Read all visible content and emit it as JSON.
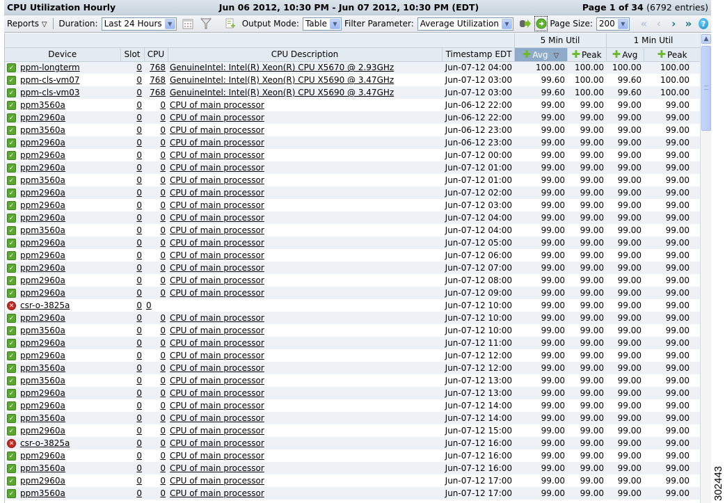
{
  "title": "CPU Utilization Hourly",
  "date_range": "Jun 06 2012, 10:30 PM - Jun 07 2012, 10:30 PM (EDT)",
  "pagination": {
    "page_label": "Page 1 of 34",
    "entries_label": "(6792 entries)"
  },
  "toolbar": {
    "reports_label": "Reports",
    "duration_label": "Duration:",
    "duration_value": "Last 24 Hours",
    "output_mode_label": "Output Mode:",
    "output_mode_value": "Table",
    "filter_param_label": "Filter Parameter:",
    "filter_param_value": "Average Utilization",
    "page_size_label": "Page Size:",
    "page_size_value": "200",
    "icons": [
      "calendar-icon",
      "filter-icon",
      "export-icon",
      "export-data-icon",
      "go-icon",
      "first-page-icon",
      "prev-page-icon",
      "next-page-icon",
      "last-page-icon",
      "help-icon"
    ]
  },
  "table": {
    "group_headers": {
      "five_min": "5 Min Util",
      "one_min": "1 Min Util"
    },
    "columns": {
      "device": "Device",
      "slot": "Slot",
      "cpu": "CPU",
      "cpu_desc": "CPU Description",
      "timestamp": "Timestamp EDT",
      "avg5": "Avg",
      "peak5": "Peak",
      "avg1": "Avg",
      "peak1": "Peak"
    },
    "sorted_column": "5 Min Util Avg",
    "rows": [
      {
        "status": "ok",
        "device": "ppm-longterm",
        "slot": "0",
        "cpu": "768",
        "desc": "GenuineIntel: Intel(R) Xeon(R) CPU X5670 @ 2.93GHz",
        "ts": "Jun-07-12 04:00",
        "avg5": "100.00",
        "peak5": "100.00",
        "avg1": "100.00",
        "peak1": "100.00"
      },
      {
        "status": "ok",
        "device": "ppm-cls-vm07",
        "slot": "0",
        "cpu": "768",
        "desc": "GenuineIntel: Intel(R) Xeon(R) CPU X5690 @ 3.47GHz",
        "ts": "Jun-07-12 03:00",
        "avg5": "99.60",
        "peak5": "100.00",
        "avg1": "99.60",
        "peak1": "100.00"
      },
      {
        "status": "ok",
        "device": "ppm-cls-vm03",
        "slot": "0",
        "cpu": "768",
        "desc": "GenuineIntel: Intel(R) Xeon(R) CPU X5690 @ 3.47GHz",
        "ts": "Jun-07-12 03:00",
        "avg5": "99.60",
        "peak5": "100.00",
        "avg1": "99.60",
        "peak1": "100.00"
      },
      {
        "status": "ok",
        "device": "ppm3560a",
        "slot": "0",
        "cpu": "0",
        "desc": "CPU of main processor",
        "ts": "Jun-06-12 22:00",
        "avg5": "99.00",
        "peak5": "99.00",
        "avg1": "99.00",
        "peak1": "99.00"
      },
      {
        "status": "ok",
        "device": "ppm2960a",
        "slot": "0",
        "cpu": "0",
        "desc": "CPU of main processor",
        "ts": "Jun-06-12 22:00",
        "avg5": "99.00",
        "peak5": "99.00",
        "avg1": "99.00",
        "peak1": "99.00"
      },
      {
        "status": "ok",
        "device": "ppm3560a",
        "slot": "0",
        "cpu": "0",
        "desc": "CPU of main processor",
        "ts": "Jun-06-12 23:00",
        "avg5": "99.00",
        "peak5": "99.00",
        "avg1": "99.00",
        "peak1": "99.00"
      },
      {
        "status": "ok",
        "device": "ppm2960a",
        "slot": "0",
        "cpu": "0",
        "desc": "CPU of main processor",
        "ts": "Jun-06-12 23:00",
        "avg5": "99.00",
        "peak5": "99.00",
        "avg1": "99.00",
        "peak1": "99.00"
      },
      {
        "status": "ok",
        "device": "ppm2960a",
        "slot": "0",
        "cpu": "0",
        "desc": "CPU of main processor",
        "ts": "Jun-07-12 00:00",
        "avg5": "99.00",
        "peak5": "99.00",
        "avg1": "99.00",
        "peak1": "99.00"
      },
      {
        "status": "ok",
        "device": "ppm2960a",
        "slot": "0",
        "cpu": "0",
        "desc": "CPU of main processor",
        "ts": "Jun-07-12 01:00",
        "avg5": "99.00",
        "peak5": "99.00",
        "avg1": "99.00",
        "peak1": "99.00"
      },
      {
        "status": "ok",
        "device": "ppm3560a",
        "slot": "0",
        "cpu": "0",
        "desc": "CPU of main processor",
        "ts": "Jun-07-12 01:00",
        "avg5": "99.00",
        "peak5": "99.00",
        "avg1": "99.00",
        "peak1": "99.00"
      },
      {
        "status": "ok",
        "device": "ppm2960a",
        "slot": "0",
        "cpu": "0",
        "desc": "CPU of main processor",
        "ts": "Jun-07-12 02:00",
        "avg5": "99.00",
        "peak5": "99.00",
        "avg1": "99.00",
        "peak1": "99.00"
      },
      {
        "status": "ok",
        "device": "ppm2960a",
        "slot": "0",
        "cpu": "0",
        "desc": "CPU of main processor",
        "ts": "Jun-07-12 03:00",
        "avg5": "99.00",
        "peak5": "99.00",
        "avg1": "99.00",
        "peak1": "99.00"
      },
      {
        "status": "ok",
        "device": "ppm2960a",
        "slot": "0",
        "cpu": "0",
        "desc": "CPU of main processor",
        "ts": "Jun-07-12 04:00",
        "avg5": "99.00",
        "peak5": "99.00",
        "avg1": "99.00",
        "peak1": "99.00"
      },
      {
        "status": "ok",
        "device": "ppm3560a",
        "slot": "0",
        "cpu": "0",
        "desc": "CPU of main processor",
        "ts": "Jun-07-12 04:00",
        "avg5": "99.00",
        "peak5": "99.00",
        "avg1": "99.00",
        "peak1": "99.00"
      },
      {
        "status": "ok",
        "device": "ppm2960a",
        "slot": "0",
        "cpu": "0",
        "desc": "CPU of main processor",
        "ts": "Jun-07-12 05:00",
        "avg5": "99.00",
        "peak5": "99.00",
        "avg1": "99.00",
        "peak1": "99.00"
      },
      {
        "status": "ok",
        "device": "ppm2960a",
        "slot": "0",
        "cpu": "0",
        "desc": "CPU of main processor",
        "ts": "Jun-07-12 06:00",
        "avg5": "99.00",
        "peak5": "99.00",
        "avg1": "99.00",
        "peak1": "99.00"
      },
      {
        "status": "ok",
        "device": "ppm2960a",
        "slot": "0",
        "cpu": "0",
        "desc": "CPU of main processor",
        "ts": "Jun-07-12 07:00",
        "avg5": "99.00",
        "peak5": "99.00",
        "avg1": "99.00",
        "peak1": "99.00"
      },
      {
        "status": "ok",
        "device": "ppm2960a",
        "slot": "0",
        "cpu": "0",
        "desc": "CPU of main processor",
        "ts": "Jun-07-12 08:00",
        "avg5": "99.00",
        "peak5": "99.00",
        "avg1": "99.00",
        "peak1": "99.00"
      },
      {
        "status": "ok",
        "device": "ppm2960a",
        "slot": "0",
        "cpu": "0",
        "desc": "CPU of main processor",
        "ts": "Jun-07-12 09:00",
        "avg5": "99.00",
        "peak5": "99.00",
        "avg1": "99.00",
        "peak1": "99.00"
      },
      {
        "status": "err",
        "device": "csr-o-3825a",
        "slot": "0",
        "cpu": "0",
        "desc": "",
        "ts": "Jun-07-12 10:00",
        "avg5": "99.00",
        "peak5": "99.00",
        "avg1": "99.00",
        "peak1": "99.00"
      },
      {
        "status": "ok",
        "device": "ppm2960a",
        "slot": "0",
        "cpu": "0",
        "desc": "CPU of main processor",
        "ts": "Jun-07-12 10:00",
        "avg5": "99.00",
        "peak5": "99.00",
        "avg1": "99.00",
        "peak1": "99.00"
      },
      {
        "status": "ok",
        "device": "ppm3560a",
        "slot": "0",
        "cpu": "0",
        "desc": "CPU of main processor",
        "ts": "Jun-07-12 10:00",
        "avg5": "99.00",
        "peak5": "99.00",
        "avg1": "99.00",
        "peak1": "99.00"
      },
      {
        "status": "ok",
        "device": "ppm2960a",
        "slot": "0",
        "cpu": "0",
        "desc": "CPU of main processor",
        "ts": "Jun-07-12 11:00",
        "avg5": "99.00",
        "peak5": "99.00",
        "avg1": "99.00",
        "peak1": "99.00"
      },
      {
        "status": "ok",
        "device": "ppm2960a",
        "slot": "0",
        "cpu": "0",
        "desc": "CPU of main processor",
        "ts": "Jun-07-12 12:00",
        "avg5": "99.00",
        "peak5": "99.00",
        "avg1": "99.00",
        "peak1": "99.00"
      },
      {
        "status": "ok",
        "device": "ppm3560a",
        "slot": "0",
        "cpu": "0",
        "desc": "CPU of main processor",
        "ts": "Jun-07-12 12:00",
        "avg5": "99.00",
        "peak5": "99.00",
        "avg1": "99.00",
        "peak1": "99.00"
      },
      {
        "status": "ok",
        "device": "ppm3560a",
        "slot": "0",
        "cpu": "0",
        "desc": "CPU of main processor",
        "ts": "Jun-07-12 13:00",
        "avg5": "99.00",
        "peak5": "99.00",
        "avg1": "99.00",
        "peak1": "99.00"
      },
      {
        "status": "ok",
        "device": "ppm2960a",
        "slot": "0",
        "cpu": "0",
        "desc": "CPU of main processor",
        "ts": "Jun-07-12 13:00",
        "avg5": "99.00",
        "peak5": "99.00",
        "avg1": "99.00",
        "peak1": "99.00"
      },
      {
        "status": "ok",
        "device": "ppm2960a",
        "slot": "0",
        "cpu": "0",
        "desc": "CPU of main processor",
        "ts": "Jun-07-12 14:00",
        "avg5": "99.00",
        "peak5": "99.00",
        "avg1": "99.00",
        "peak1": "99.00"
      },
      {
        "status": "ok",
        "device": "ppm3560a",
        "slot": "0",
        "cpu": "0",
        "desc": "CPU of main processor",
        "ts": "Jun-07-12 14:00",
        "avg5": "99.00",
        "peak5": "99.00",
        "avg1": "99.00",
        "peak1": "99.00"
      },
      {
        "status": "ok",
        "device": "ppm2960a",
        "slot": "0",
        "cpu": "0",
        "desc": "CPU of main processor",
        "ts": "Jun-07-12 15:00",
        "avg5": "99.00",
        "peak5": "99.00",
        "avg1": "99.00",
        "peak1": "99.00"
      },
      {
        "status": "err",
        "device": "csr-o-3825a",
        "slot": "0",
        "cpu": "0",
        "desc": "CPU of main processor",
        "ts": "Jun-07-12 16:00",
        "avg5": "99.00",
        "peak5": "99.00",
        "avg1": "99.00",
        "peak1": "99.00"
      },
      {
        "status": "ok",
        "device": "ppm2960a",
        "slot": "0",
        "cpu": "0",
        "desc": "CPU of main processor",
        "ts": "Jun-07-12 16:00",
        "avg5": "99.00",
        "peak5": "99.00",
        "avg1": "99.00",
        "peak1": "99.00"
      },
      {
        "status": "ok",
        "device": "ppm3560a",
        "slot": "0",
        "cpu": "0",
        "desc": "CPU of main processor",
        "ts": "Jun-07-12 16:00",
        "avg5": "99.00",
        "peak5": "99.00",
        "avg1": "99.00",
        "peak1": "99.00"
      },
      {
        "status": "ok",
        "device": "ppm2960a",
        "slot": "0",
        "cpu": "0",
        "desc": "CPU of main processor",
        "ts": "Jun-07-12 17:00",
        "avg5": "99.00",
        "peak5": "99.00",
        "avg1": "99.00",
        "peak1": "99.00"
      },
      {
        "status": "ok",
        "device": "ppm3560a",
        "slot": "0",
        "cpu": "0",
        "desc": "CPU of main processor",
        "ts": "Jun-07-12 17:00",
        "avg5": "99.00",
        "peak5": "99.00",
        "avg1": "99.00",
        "peak1": "99.00"
      }
    ]
  },
  "figure_id": "302443"
}
